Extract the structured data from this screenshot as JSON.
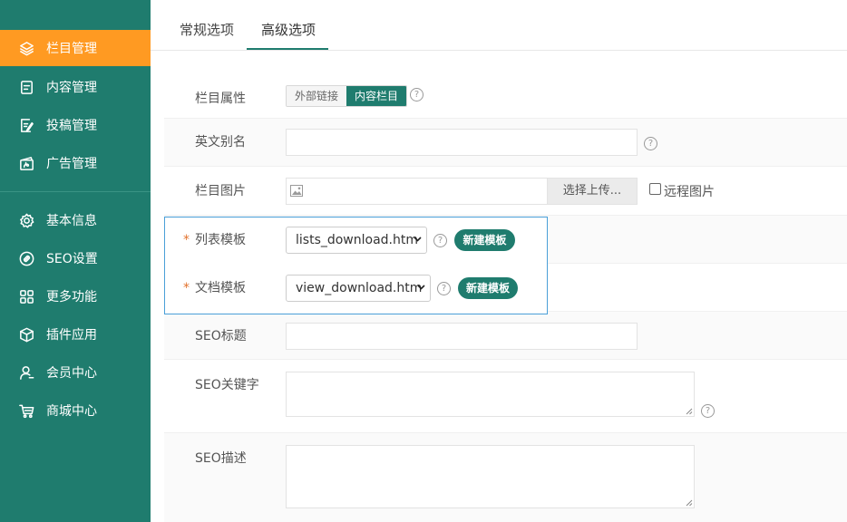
{
  "sidebar": {
    "items": [
      {
        "label": "栏目管理",
        "icon": "layers-icon",
        "active": true
      },
      {
        "label": "内容管理",
        "icon": "document-icon"
      },
      {
        "label": "投稿管理",
        "icon": "edit-icon"
      },
      {
        "label": "广告管理",
        "icon": "ad-icon"
      },
      {
        "label": "基本信息",
        "icon": "gear-icon"
      },
      {
        "label": "SEO设置",
        "icon": "seo-icon"
      },
      {
        "label": "更多功能",
        "icon": "grid-icon"
      },
      {
        "label": "插件应用",
        "icon": "cube-icon"
      },
      {
        "label": "会员中心",
        "icon": "user-icon"
      },
      {
        "label": "商城中心",
        "icon": "cart-icon"
      }
    ],
    "accent": "#ff9a22",
    "background": "#1f7c6e"
  },
  "tabs": [
    {
      "label": "常规选项",
      "active": false
    },
    {
      "label": "高级选项",
      "active": true
    }
  ],
  "form": {
    "attr": {
      "label": "栏目属性",
      "options": [
        "外部链接",
        "内容栏目"
      ],
      "selected": "内容栏目"
    },
    "alias": {
      "label": "英文别名",
      "value": ""
    },
    "image": {
      "label": "栏目图片",
      "value": "",
      "upload_label": "选择上传...",
      "remote_label": "远程图片",
      "remote_checked": false
    },
    "list_tpl": {
      "label": "列表模板",
      "required_mark": "*",
      "value": "lists_download.htm",
      "new_label": "新建模板"
    },
    "doc_tpl": {
      "label": "文档模板",
      "required_mark": "*",
      "value": "view_download.htm",
      "new_label": "新建模板"
    },
    "seo_title": {
      "label": "SEO标题",
      "value": ""
    },
    "seo_keywords": {
      "label": "SEO关键字",
      "value": ""
    },
    "seo_desc": {
      "label": "SEO描述",
      "value": ""
    },
    "help_glyph": "?"
  }
}
